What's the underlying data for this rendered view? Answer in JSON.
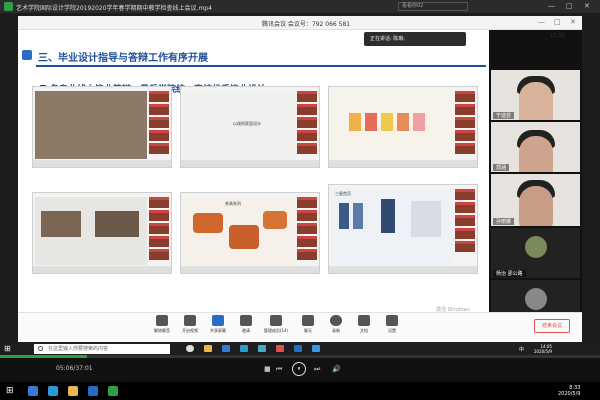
{
  "player": {
    "title": "艺术学院国际设计学院20192020学年春学期期中教学检查线上会议.mp4",
    "search_placeholder": "看看你02",
    "controls": [
      "—",
      "□",
      "✕"
    ],
    "progress_fraction": 0.145,
    "time": "05:06/37:01",
    "buttons": {
      "stop": "■",
      "prev": "⏮",
      "play": "⏸",
      "next": "⏭",
      "volume": "🔊"
    }
  },
  "meeting": {
    "title": "腾讯会议 会议号：792 066 581",
    "window_controls": [
      "—",
      "□",
      "✕"
    ],
    "speaking": "正在讲话: 陈琳;",
    "time": "11:33",
    "slide": {
      "heading1": "三、毕业设计指导与答辩工作有序开展",
      "heading2": "各专业线上毕业答辩，最后学院统一审核优秀毕业设计",
      "thumb_caption_1": "以颂柯家居设计",
      "thumb_caption_2": "茶具系列",
      "thumb_caption_3": "三星首页",
      "watermark": "激活 Windows",
      "watermark_sub": "转到\"设置\"以激活 Windows。"
    },
    "participants": [
      {
        "name": "于迪芸"
      },
      {
        "name": "郭涵"
      },
      {
        "name": "孙丽娜"
      },
      {
        "name": "杨治 邵公路"
      },
      {
        "name": "刘新"
      }
    ],
    "toolbar": [
      {
        "label": "解除静音"
      },
      {
        "label": "开启视频"
      },
      {
        "label": "共享屏幕"
      },
      {
        "label": "邀请"
      },
      {
        "label": "管理成员(14)"
      },
      {
        "label": "聊天"
      },
      {
        "label": "录制"
      },
      {
        "label": "文档"
      },
      {
        "label": "设置"
      }
    ],
    "end_label": "结束会议"
  },
  "rec_taskbar": {
    "search_placeholder": "在这里输入你要搜索的内容",
    "clock_time": "14:05",
    "clock_date": "2020/5/9",
    "lang": "中"
  },
  "host_taskbar": {
    "clock_time": "8:33",
    "clock_date": "2020/5/9"
  },
  "colors": {
    "accent": "#1e4f9a",
    "progress": "#2ea043",
    "end": "#e0504d"
  }
}
